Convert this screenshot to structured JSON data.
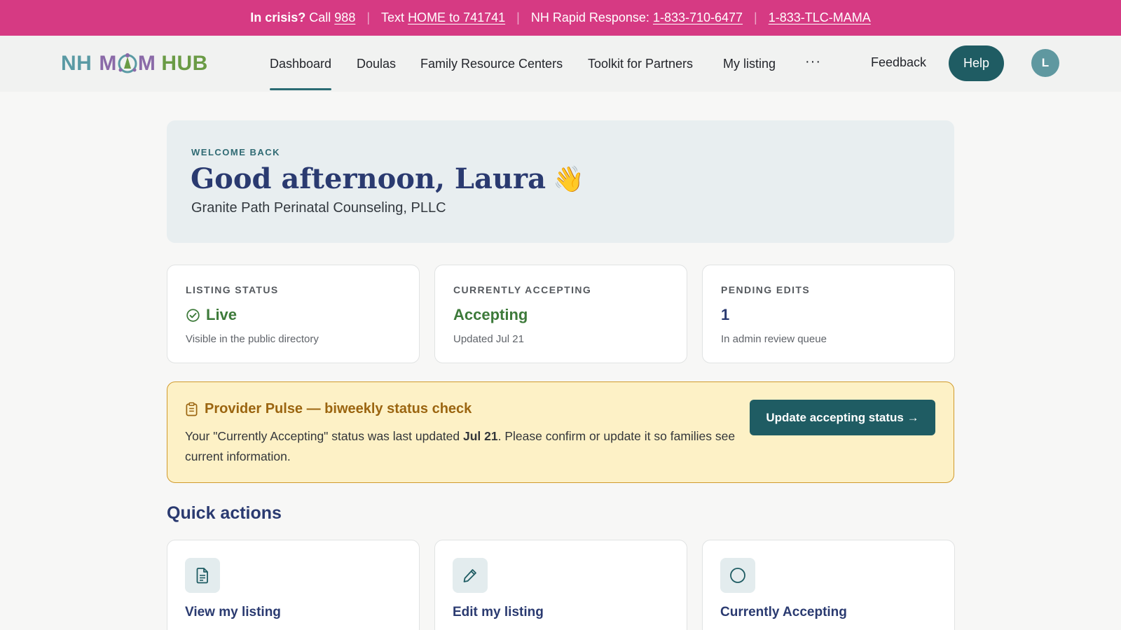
{
  "crisis_bar": {
    "lead": "In crisis?",
    "call_prefix": "Call",
    "call_number": "988",
    "text_prefix": "Text",
    "text_link": "HOME to 741741",
    "rapid_prefix": "NH Rapid Response:",
    "rapid_number": "1-833-710-6477",
    "tlc_number": "1-833-TLC-MAMA",
    "separator": "|",
    "background": "#d63a83"
  },
  "logo": {
    "nh": "NH",
    "mom": "M",
    "mom_end": "M",
    "hub": "HUB"
  },
  "nav": {
    "items": [
      "Dashboard",
      "Doulas",
      "Family Resource Centers",
      "Toolkit for Partners",
      "My listing"
    ],
    "active": "Dashboard",
    "more": "···",
    "feedback": "Feedback",
    "help": "Help",
    "avatar_initial": "L"
  },
  "welcome": {
    "eyebrow": "WELCOME BACK",
    "greeting": "Good afternoon, Laura",
    "emoji": "👋",
    "org": "Granite Path Perinatal Counseling, PLLC"
  },
  "stats": [
    {
      "label": "LISTING STATUS",
      "value": "Live",
      "icon": "check-circle-icon",
      "sub": "Visible in the public directory"
    },
    {
      "label": "CURRENTLY ACCEPTING",
      "value": "Accepting",
      "sub": "Updated Jul 21"
    },
    {
      "label": "PENDING EDITS",
      "value": "1",
      "sub": "In admin review queue"
    }
  ],
  "pulse": {
    "icon": "clipboard-icon",
    "title": "Provider Pulse — biweekly status check",
    "text_before": "Your \"Currently Accepting\" status was last updated ",
    "text_date": "Jul 21",
    "text_after": ". Please confirm or update it so families see current information.",
    "button": "Update accepting status →"
  },
  "quick_actions": {
    "title": "Quick actions",
    "items": [
      {
        "label": "View my listing",
        "icon": "document-icon"
      },
      {
        "label": "Edit my listing",
        "icon": "pencil-icon"
      },
      {
        "label": "Currently Accepting",
        "icon": "circle-icon"
      }
    ]
  },
  "colors": {
    "accent": "#1f5c63",
    "navy": "#2a3a70",
    "green": "#3d7a3a",
    "warning_bg": "#fdf1c6",
    "warning_text": "#9b6510"
  }
}
